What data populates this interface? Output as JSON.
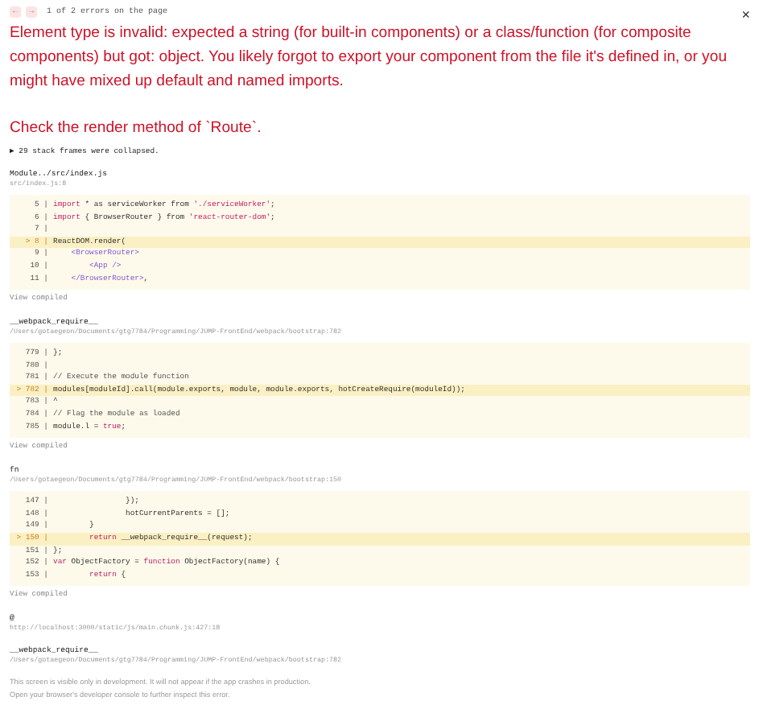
{
  "nav": {
    "prev": "←",
    "next": "→",
    "counter": "1 of 2 errors on the page"
  },
  "close": "×",
  "message": "Element type is invalid: expected a string (for built-in components) or a class/function (for composite components) but got: object. You likely forgot to export your component from the file it's defined in, or you might have mixed up default and named imports.",
  "check": "Check the render method of `Route`.",
  "collapsed": "▶ 29 stack frames were collapsed.",
  "frames": [
    {
      "function": "Module../src/index.js",
      "location": "src/index.js:8",
      "view_compiled": "View compiled",
      "code": [
        {
          "number": "5 |",
          "highlighted": false,
          "parts": [
            {
              "kind": "keyword",
              "text": "import"
            },
            {
              "kind": "plain",
              "text": " * as serviceWorker from "
            },
            {
              "kind": "string",
              "text": "'./serviceWorker'"
            },
            {
              "kind": "plain",
              "text": ";"
            }
          ]
        },
        {
          "number": "6 |",
          "highlighted": false,
          "parts": [
            {
              "kind": "keyword",
              "text": "import"
            },
            {
              "kind": "plain",
              "text": " { BrowserRouter } from "
            },
            {
              "kind": "string",
              "text": "'react-router-dom'"
            },
            {
              "kind": "plain",
              "text": ";"
            }
          ]
        },
        {
          "number": "7 |",
          "highlighted": false
        },
        {
          "number": "> 8 |",
          "highlighted": true,
          "parts": [
            {
              "kind": "plain",
              "text": "ReactDOM.render("
            }
          ]
        },
        {
          "number": "9 |",
          "highlighted": false,
          "parts": [
            {
              "kind": "tag",
              "text": "    <BrowserRouter>"
            }
          ]
        },
        {
          "number": "10 |",
          "highlighted": false,
          "parts": [
            {
              "kind": "tag",
              "text": "        <App />"
            }
          ]
        },
        {
          "number": "11 |",
          "highlighted": false,
          "parts": [
            {
              "kind": "tag",
              "text": "    </BrowserRouter>"
            },
            {
              "kind": "plain",
              "text": ","
            }
          ]
        }
      ]
    },
    {
      "function": "__webpack_require__",
      "location": "/Users/gotaegeon/Documents/gtg7784/Programming/JUMP-FrontEnd/webpack/bootstrap:782",
      "view_compiled": "View compiled",
      "code": [
        {
          "number": "779 |",
          "highlighted": false,
          "parts": [
            {
              "kind": "plain",
              "text": "};"
            }
          ]
        },
        {
          "number": "780 |",
          "highlighted": false
        },
        {
          "number": "781 |",
          "highlighted": false,
          "parts": [
            {
              "kind": "comment",
              "text": "// Execute the module function"
            }
          ]
        },
        {
          "number": "> 782 |",
          "highlighted": true,
          "parts": [
            {
              "kind": "plain",
              "text": "modules[moduleId].call(module.exports, module, module.exports, hotCreateRequire(moduleId));"
            }
          ]
        },
        {
          "number": "783 |",
          "highlighted": false,
          "parts": [
            {
              "kind": "plain",
              "text": "^"
            }
          ]
        },
        {
          "number": "784 |",
          "highlighted": false,
          "parts": [
            {
              "kind": "comment",
              "text": "// Flag the module as loaded"
            }
          ]
        },
        {
          "number": "785 |",
          "highlighted": false,
          "parts": [
            {
              "kind": "plain",
              "text": "module.l = "
            },
            {
              "kind": "keyword",
              "text": "true"
            },
            {
              "kind": "plain",
              "text": ";"
            }
          ]
        }
      ]
    },
    {
      "function": "fn",
      "location": "/Users/gotaegeon/Documents/gtg7784/Programming/JUMP-FrontEnd/webpack/bootstrap:150",
      "view_compiled": "View compiled",
      "code": [
        {
          "number": "147 |",
          "highlighted": false,
          "parts": [
            {
              "kind": "plain",
              "text": "                });"
            }
          ]
        },
        {
          "number": "148 |",
          "highlighted": false,
          "parts": [
            {
              "kind": "plain",
              "text": "                hotCurrentParents = [];"
            }
          ]
        },
        {
          "number": "149 |",
          "highlighted": false,
          "parts": [
            {
              "kind": "plain",
              "text": "        }"
            }
          ]
        },
        {
          "number": "> 150 |",
          "highlighted": true,
          "parts": [
            {
              "kind": "keyword",
              "text": "        return"
            },
            {
              "kind": "plain",
              "text": " __webpack_require__(request);"
            }
          ]
        },
        {
          "number": "151 |",
          "highlighted": false,
          "parts": [
            {
              "kind": "plain",
              "text": "};"
            }
          ]
        },
        {
          "number": "152 |",
          "highlighted": false,
          "parts": [
            {
              "kind": "keyword",
              "text": "var"
            },
            {
              "kind": "plain",
              "text": " ObjectFactory = "
            },
            {
              "kind": "keyword",
              "text": "function"
            },
            {
              "kind": "plain",
              "text": " ObjectFactory(name) {"
            }
          ]
        },
        {
          "number": "153 |",
          "highlighted": false,
          "parts": [
            {
              "kind": "keyword",
              "text": "        return"
            },
            {
              "kind": "plain",
              "text": " {"
            }
          ]
        }
      ]
    },
    {
      "function": "@",
      "location": "http://localhost:3000/static/js/main.chunk.js:427:18"
    },
    {
      "function": "__webpack_require__",
      "location": "/Users/gotaegeon/Documents/gtg7784/Programming/JUMP-FrontEnd/webpack/bootstrap:782"
    }
  ],
  "footer": [
    "This screen is visible only in development. It will not appear if the app crashes in production.",
    "Open your browser's developer console to further inspect this error."
  ]
}
